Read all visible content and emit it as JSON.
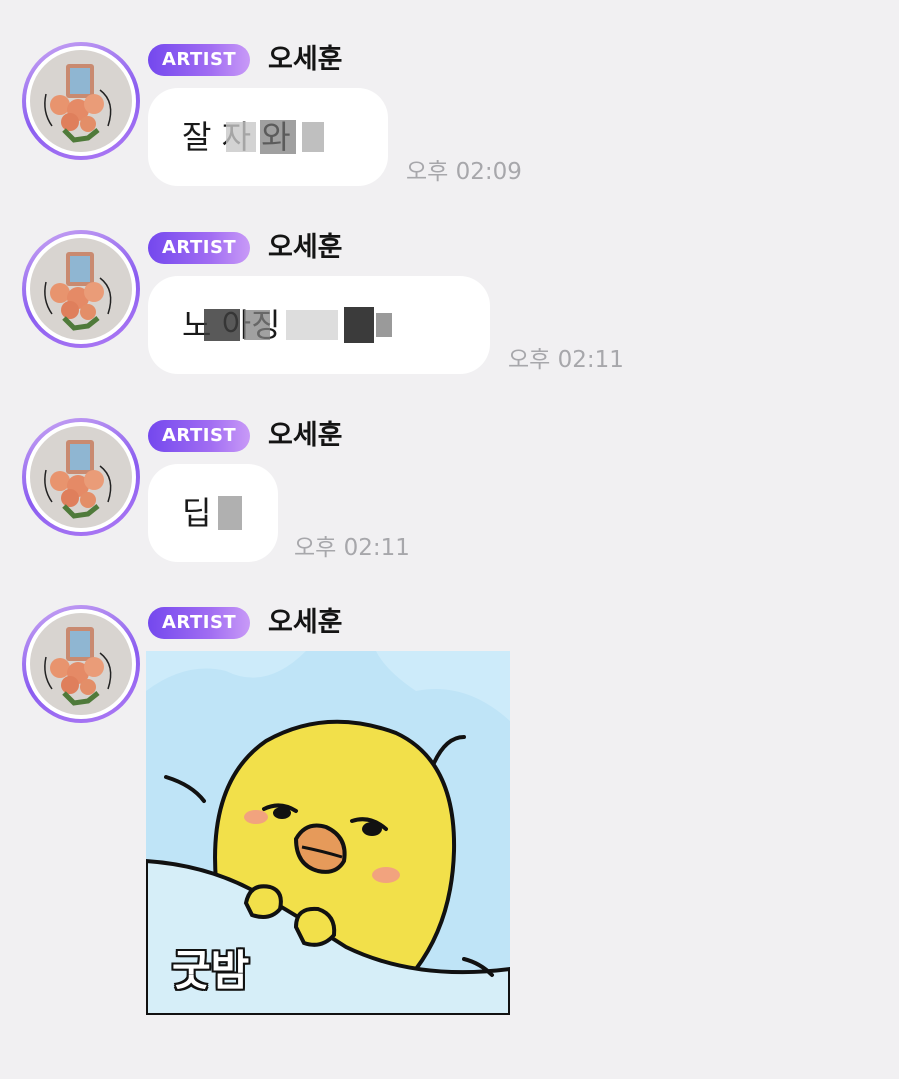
{
  "messages": [
    {
      "badge": "ARTIST",
      "sender": "오세훈",
      "text": "잘 자 와",
      "time": "오후 02:09"
    },
    {
      "badge": "ARTIST",
      "sender": "오세훈",
      "text": "노 아징",
      "time": "오후 02:11"
    },
    {
      "badge": "ARTIST",
      "sender": "오세훈",
      "text": "딥",
      "time": "오후 02:11"
    },
    {
      "badge": "ARTIST",
      "sender": "오세훈",
      "sticker_text": "굿밤",
      "sticker_icon": "yellow-chick-sticker"
    }
  ],
  "colors": {
    "background": "#f1f0f2",
    "bubble": "#ffffff",
    "badge_start": "#7448ee",
    "badge_end": "#c89af7",
    "time": "#a7a7ab",
    "sticker_sky": "#bfe4f7",
    "chick": "#f2e04a"
  }
}
